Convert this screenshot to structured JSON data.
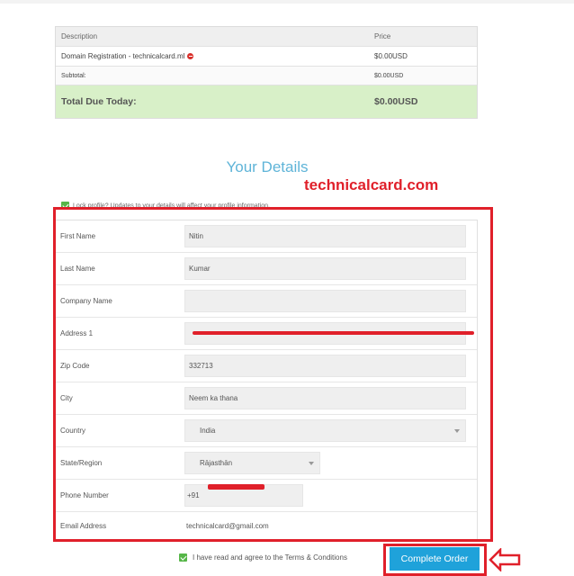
{
  "order_summary": {
    "header": {
      "description": "Description",
      "price": "Price"
    },
    "item": {
      "name": "Domain Registration - technicalcard.ml",
      "price": "$0.00USD"
    },
    "subtotal": {
      "label": "Subtotal:",
      "price": "$0.00USD"
    },
    "total": {
      "label": "Total Due Today:",
      "price": "$0.00USD"
    }
  },
  "section_title": "Your Details",
  "watermark": "technicalcard.com",
  "profile_note": "Lock profile? Updates to your details will affect your profile information.",
  "form": {
    "first_name": {
      "label": "First Name",
      "value": "Nitin"
    },
    "last_name": {
      "label": "Last Name",
      "value": "Kumar"
    },
    "company_name": {
      "label": "Company Name",
      "value": ""
    },
    "address1": {
      "label": "Address 1",
      "value": ""
    },
    "zip_code": {
      "label": "Zip Code",
      "value": "332713"
    },
    "city": {
      "label": "City",
      "value": "Neem ka thana"
    },
    "country": {
      "label": "Country",
      "value": "India"
    },
    "state": {
      "label": "State/Region",
      "value": "Rājasthān"
    },
    "phone": {
      "label": "Phone Number",
      "prefix": "+91"
    },
    "email": {
      "label": "Email Address",
      "value": "technicalcard@gmail.com"
    }
  },
  "terms_text": "I have read and agree to the Terms & Conditions",
  "complete_button": "Complete Order",
  "colors": {
    "accent": "#1fa2da",
    "annotation_red": "#e0202a",
    "total_bg": "#d8f0c8",
    "check_green": "#56b648"
  }
}
